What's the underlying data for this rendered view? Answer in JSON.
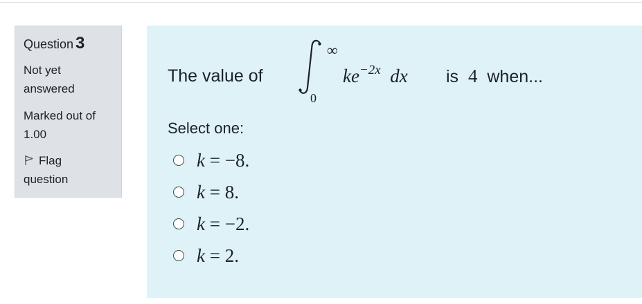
{
  "question_info": {
    "label": "Question",
    "number": "3",
    "state_line1": "Not yet",
    "state_line2": "answered",
    "grade_line1": "Marked out of",
    "grade_line2": "1.00",
    "flag_line1": "Flag",
    "flag_line2": "question",
    "flag_icon": "flag-outline-icon"
  },
  "question": {
    "text_before": "The value of",
    "integral_upper": "∞",
    "integral_lower": "0",
    "integrand_var": "ke",
    "integrand_exp": "−2x",
    "differential": "dx",
    "text_is": "is",
    "value": "4",
    "text_after": "when..."
  },
  "prompt": "Select one:",
  "options": [
    {
      "var": "k",
      "rest": " = −8."
    },
    {
      "var": "k",
      "rest": " = 8."
    },
    {
      "var": "k",
      "rest": " = −2."
    },
    {
      "var": "k",
      "rest": " = 2."
    }
  ],
  "colors": {
    "info_bg": "#dee2e6",
    "content_bg": "#def2f8",
    "text": "#1d2125"
  }
}
